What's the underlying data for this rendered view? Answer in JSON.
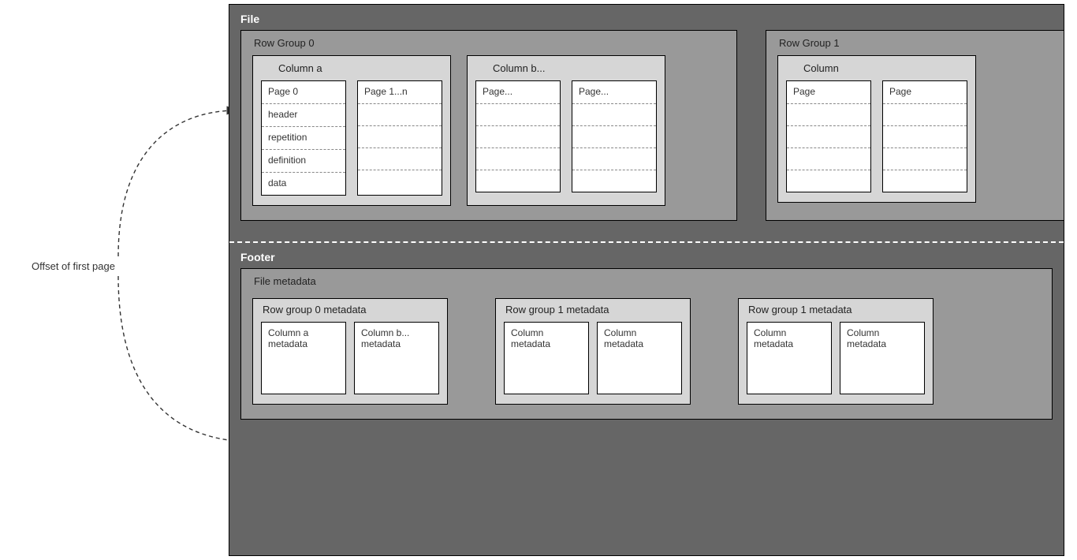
{
  "annotation": "Offset of first page",
  "file": {
    "label": "File",
    "rowGroups": [
      {
        "title": "Row Group 0",
        "columns": [
          {
            "title": "Column a",
            "pages": [
              {
                "title": "Page 0",
                "segs": [
                  "header",
                  "repetition",
                  "definition",
                  "data"
                ]
              },
              {
                "title": "Page 1...n",
                "segs": [
                  "",
                  "",
                  "",
                  ""
                ]
              }
            ]
          },
          {
            "title": "Column b...",
            "pages": [
              {
                "title": "Page...",
                "segs": [
                  "",
                  "",
                  "",
                  ""
                ]
              },
              {
                "title": "Page...",
                "segs": [
                  "",
                  "",
                  "",
                  ""
                ]
              }
            ]
          }
        ]
      },
      {
        "title": "Row Group 1",
        "columns": [
          {
            "title": "Column",
            "pages": [
              {
                "title": "Page",
                "segs": [
                  "",
                  "",
                  "",
                  ""
                ]
              },
              {
                "title": "Page",
                "segs": [
                  "",
                  "",
                  "",
                  ""
                ]
              }
            ]
          }
        ]
      }
    ]
  },
  "footer": {
    "label": "Footer",
    "fileMetadata": {
      "title": "File metadata",
      "rowGroupsMeta": [
        {
          "title": "Row group 0 metadata",
          "cols": [
            "Column a metadata",
            "Column b... metadata"
          ]
        },
        {
          "title": "Row group 1 metadata",
          "cols": [
            "Column metadata",
            "Column metadata"
          ]
        },
        {
          "title": "Row group 1 metadata",
          "cols": [
            "Column metadata",
            "Column metadata"
          ]
        }
      ]
    }
  }
}
